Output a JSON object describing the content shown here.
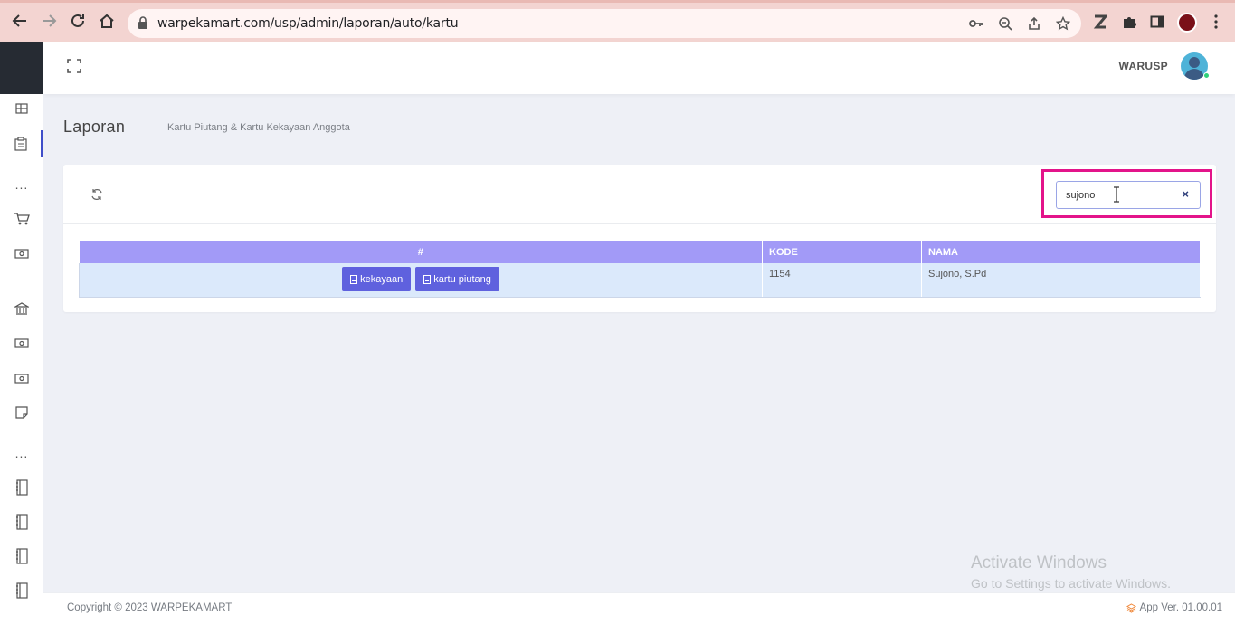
{
  "browser": {
    "url": "warpekamart.com/usp/admin/laporan/auto/kartu"
  },
  "header": {
    "username": "WARUSP"
  },
  "page": {
    "title": "Laporan",
    "subtitle": "Kartu Piutang & Kartu Kekayaan Anggota"
  },
  "search": {
    "value": "sujono",
    "clear_label": "×"
  },
  "table": {
    "columns": [
      "#",
      "KODE",
      "NAMA"
    ],
    "rows": [
      {
        "kode": "1154",
        "nama": "Sujono, S.Pd",
        "buttons": [
          "kekayaan",
          "kartu piutang"
        ]
      }
    ]
  },
  "sidebar": {
    "dots_label": "..."
  },
  "watermark": {
    "line1": "Activate Windows",
    "line2": "Go to Settings to activate Windows."
  },
  "footer": {
    "copyright": "Copyright © 2023 WARPEKAMART",
    "app_version": "App Ver. 01.00.01"
  },
  "colors": {
    "accent": "#5f61de",
    "table_header": "#a29af7",
    "row_bg": "#dbe9fb",
    "highlight": "#e3148a"
  }
}
